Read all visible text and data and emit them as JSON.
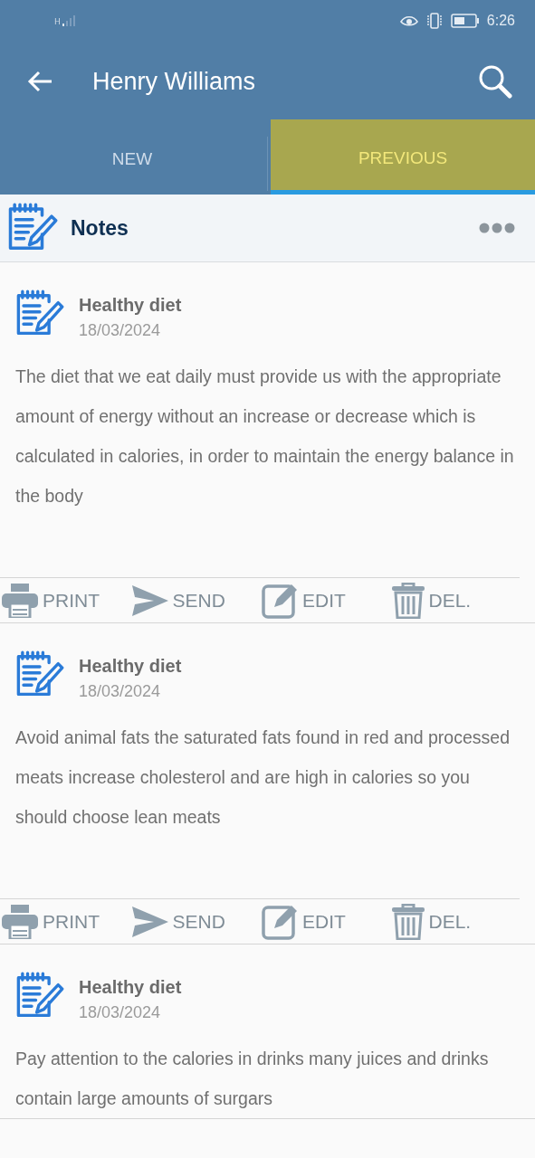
{
  "status_bar": {
    "network": "H",
    "time": "6:26"
  },
  "header": {
    "title": "Henry Williams"
  },
  "tabs": [
    {
      "label": "NEW",
      "selected": false
    },
    {
      "label": "PREVIOUS",
      "selected": true
    }
  ],
  "section": {
    "title": "Notes"
  },
  "notes": [
    {
      "title": "Healthy diet",
      "date": "18/03/2024",
      "body": "The diet that we eat daily must provide us with the appropriate amount of energy without an increase or decrease which is calculated in calories, in order to maintain the energy balance in the body",
      "actions": [
        {
          "kind": "print",
          "label": "PRINT"
        },
        {
          "kind": "send",
          "label": "SEND"
        },
        {
          "kind": "edit",
          "label": "EDIT"
        },
        {
          "kind": "delete",
          "label": "DEL."
        }
      ]
    },
    {
      "title": "Healthy diet",
      "date": "18/03/2024",
      "body": "Avoid animal fats the saturated fats found in red and processed meats increase cholesterol and are high in calories so you should choose lean meats",
      "actions": [
        {
          "kind": "print",
          "label": "PRINT"
        },
        {
          "kind": "send",
          "label": "SEND"
        },
        {
          "kind": "edit",
          "label": "EDIT"
        },
        {
          "kind": "delete",
          "label": "DEL."
        }
      ]
    },
    {
      "title": "Healthy diet",
      "date": "18/03/2024",
      "body": "Pay attention to the calories in drinks many juices and drinks contain large amounts of surgars"
    }
  ]
}
